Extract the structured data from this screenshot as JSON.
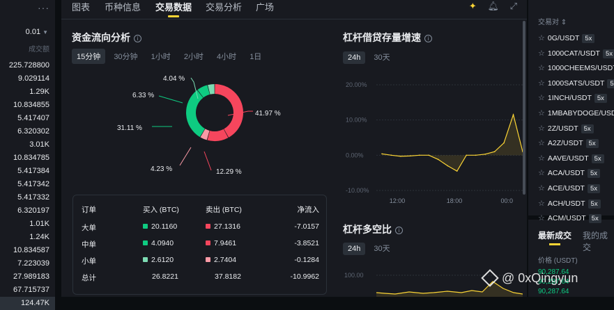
{
  "left": {
    "menu": "···",
    "precision": "0.01",
    "col_header": "成交额",
    "volumes": [
      "225.728800",
      "9.029114",
      "1.29K",
      "10.834855",
      "5.417407",
      "6.320302",
      "3.01K",
      "10.834785",
      "5.417384",
      "5.417342",
      "5.417332",
      "6.320197",
      "1.01K",
      "1.24K",
      "10.834587",
      "7.223039",
      "27.989183",
      "67.715737",
      "124.47K"
    ]
  },
  "tabs": [
    "图表",
    "币种信息",
    "交易数据",
    "交易分析",
    "广场"
  ],
  "active_tab": "交易数据",
  "flow": {
    "title": "资金流向分析",
    "periods": [
      "15分钟",
      "30分钟",
      "1小时",
      "2小时",
      "4小时",
      "1日"
    ],
    "active_period": "15分钟",
    "slices": [
      {
        "label": "41.97 %",
        "value": 41.97,
        "color": "#f6465d"
      },
      {
        "label": "12.29 %",
        "value": 12.29,
        "color": "#f6465d"
      },
      {
        "label": "4.23 %",
        "value": 4.23,
        "color": "#fa9aa6"
      },
      {
        "label": "31.11 %",
        "value": 31.11,
        "color": "#0ecb81"
      },
      {
        "label": "6.33 %",
        "value": 6.33,
        "color": "#0ecb81"
      },
      {
        "label": "4.04 %",
        "value": 4.04,
        "color": "#7ddbb3"
      }
    ],
    "table": {
      "headers": [
        "订单",
        "买入 (BTC)",
        "卖出 (BTC)",
        "净流入"
      ],
      "rows": [
        {
          "name": "大单",
          "buy": "20.1160",
          "sell": "27.1316",
          "net": "-7.0157",
          "buy_color": "#0ecb81",
          "sell_color": "#f6465d"
        },
        {
          "name": "中单",
          "buy": "4.0940",
          "sell": "7.9461",
          "net": "-3.8521",
          "buy_color": "#0ecb81",
          "sell_color": "#f6465d"
        },
        {
          "name": "小单",
          "buy": "2.6120",
          "sell": "2.7404",
          "net": "-0.1284",
          "buy_color": "#7ddbb3",
          "sell_color": "#fa9aa6"
        }
      ],
      "total": {
        "name": "总计",
        "buy": "26.8221",
        "sell": "37.8182",
        "net": "-10.9962"
      }
    }
  },
  "margin_debt": {
    "title": "杠杆借贷存量增速",
    "periods": [
      "24h",
      "30天"
    ],
    "active_period": "24h"
  },
  "long_short": {
    "title": "杠杆多空比",
    "periods": [
      "24h",
      "30天"
    ],
    "active_period": "24h",
    "ytick": "100.00"
  },
  "chart_data": [
    {
      "type": "area",
      "title": "杠杆借贷存量增速",
      "yticks": [
        "20.00%",
        "10.00%",
        "0.00%",
        "-10.00%"
      ],
      "xticks": [
        "12:00",
        "18:00",
        "00:0"
      ],
      "ylim": [
        -10,
        20
      ],
      "x": [
        0,
        1,
        2,
        3,
        4,
        5,
        6,
        7,
        8,
        9,
        10,
        11,
        12,
        13,
        14,
        15
      ],
      "values": [
        0.4,
        0,
        -0.3,
        -0.2,
        0,
        0,
        -1.2,
        -3,
        -4.5,
        0,
        0,
        0.3,
        1,
        3.5,
        11.5,
        1
      ],
      "color": "#fcd535"
    },
    {
      "type": "area",
      "title": "杠杆多空比",
      "yticks": [
        "100.00"
      ],
      "color": "#fcd535"
    }
  ],
  "pairs": {
    "header": "交易对",
    "items": [
      {
        "sym": "0G/USDT",
        "lev": "5x"
      },
      {
        "sym": "1000CAT/USDT",
        "lev": "5x"
      },
      {
        "sym": "1000CHEEMS/USDT",
        "lev": ""
      },
      {
        "sym": "1000SATS/USDT",
        "lev": "5x"
      },
      {
        "sym": "1INCH/USDT",
        "lev": "5x"
      },
      {
        "sym": "1MBABYDOGE/USDT",
        "lev": ""
      },
      {
        "sym": "2Z/USDT",
        "lev": "5x"
      },
      {
        "sym": "A2Z/USDT",
        "lev": "5x"
      },
      {
        "sym": "AAVE/USDT",
        "lev": "5x"
      },
      {
        "sym": "ACA/USDT",
        "lev": "5x"
      },
      {
        "sym": "ACE/USDT",
        "lev": "5x"
      },
      {
        "sym": "ACH/USDT",
        "lev": "5x"
      },
      {
        "sym": "ACM/USDT",
        "lev": "5x"
      }
    ]
  },
  "trades": {
    "tabs": [
      "最新成交",
      "我的成交"
    ],
    "price_header": "价格 (USDT)",
    "prices": [
      "90,287.64",
      "90,287.64",
      "90,287.64"
    ]
  },
  "watermark": "@ 0xQingyun"
}
